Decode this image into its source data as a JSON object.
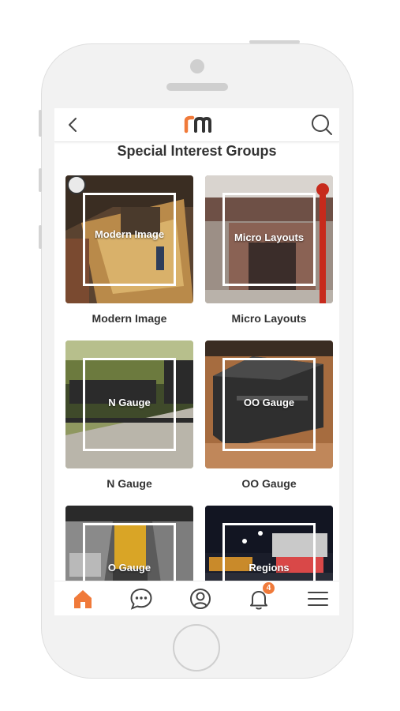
{
  "header": {
    "back_icon": "chevron-left-icon",
    "logo_text": "rm",
    "search_icon": "search-icon"
  },
  "page_title": "Special Interest Groups",
  "groups": [
    {
      "overlay": "Modern Image",
      "caption": "Modern Image"
    },
    {
      "overlay": "Micro Layouts",
      "caption": "Micro Layouts"
    },
    {
      "overlay": "N Gauge",
      "caption": "N Gauge"
    },
    {
      "overlay": "OO Gauge",
      "caption": "OO Gauge"
    },
    {
      "overlay": "O Gauge",
      "caption": ""
    },
    {
      "overlay": "Regions",
      "caption": ""
    }
  ],
  "bottom_nav": [
    {
      "icon": "home-icon",
      "active": true
    },
    {
      "icon": "chat-icon",
      "active": false
    },
    {
      "icon": "profile-icon",
      "active": false
    },
    {
      "icon": "bell-icon",
      "active": false,
      "badge": "4"
    },
    {
      "icon": "menu-icon",
      "active": false
    }
  ],
  "colors": {
    "accent": "#f07a3a",
    "text": "#333333",
    "icon": "#444444"
  }
}
